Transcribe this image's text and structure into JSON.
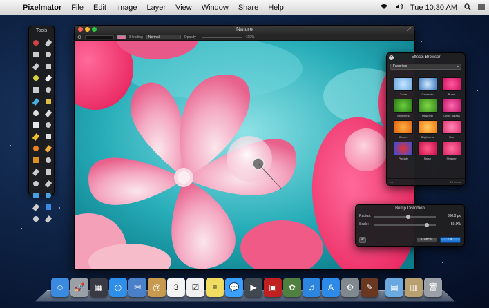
{
  "menubar": {
    "app_name": "Pixelmator",
    "items": [
      "File",
      "Edit",
      "Image",
      "Layer",
      "View",
      "Window",
      "Share",
      "Help"
    ],
    "clock": "Tue 10:30 AM"
  },
  "tools_palette": {
    "title": "Tools",
    "tools": [
      "move-tool",
      "arrow-select-tool",
      "rect-marquee-tool",
      "ellipse-marquee-tool",
      "lasso-tool",
      "polygon-lasso-tool",
      "magic-wand-tool",
      "eyedropper-tool",
      "crop-tool",
      "slice-tool",
      "brush-tool",
      "pencil-tool",
      "eraser-tool",
      "gradient-tool",
      "paint-bucket-tool",
      "blur-tool",
      "sponge-tool",
      "smudge-tool",
      "burn-tool",
      "dodge-tool",
      "clone-stamp-tool",
      "healing-tool",
      "red-eye-tool",
      "sharpen-tool",
      "pen-tool",
      "freeform-pen-tool",
      "line-tool",
      "shape-tool",
      "type-tool",
      "color-swatch",
      "zoom-tool",
      "hand-tool"
    ]
  },
  "main_window": {
    "title": "Nature",
    "options": {
      "blending_label": "Blending",
      "blending_value": "Normal",
      "opacity_label": "Opacity",
      "opacity_value": "100%"
    }
  },
  "effects_browser": {
    "title": "Effects Browser",
    "category": "Favorites",
    "effects": [
      {
        "label": "Zoom",
        "colors": [
          "#c8e4ff",
          "#6aa8e0"
        ]
      },
      {
        "label": "Gaussian",
        "colors": [
          "#d0e8ff",
          "#3a78c0"
        ]
      },
      {
        "label": "Bump",
        "colors": [
          "#ff5aa0",
          "#d0105e"
        ]
      },
      {
        "label": "Brickwork",
        "colors": [
          "#6ad040",
          "#2c7a14"
        ]
      },
      {
        "label": "Pinwheel",
        "colors": [
          "#7ed848",
          "#3a8a1c"
        ]
      },
      {
        "label": "Circle Splash",
        "colors": [
          "#ff6ab0",
          "#c0186a"
        ]
      },
      {
        "label": "Curves",
        "colors": [
          "#ffb040",
          "#e06010"
        ]
      },
      {
        "label": "Brightness",
        "colors": [
          "#ffc860",
          "#f07a10"
        ]
      },
      {
        "label": "Hue",
        "colors": [
          "#ff8ab8",
          "#e0306e"
        ]
      },
      {
        "label": "Pixelate",
        "colors": [
          "#e83030",
          "#3050e0"
        ]
      },
      {
        "label": "Noise",
        "colors": [
          "#ff5a8a",
          "#c8104a"
        ]
      },
      {
        "label": "Sharpen",
        "colors": [
          "#ff70a0",
          "#d82060"
        ]
      }
    ],
    "count": "15 Items"
  },
  "bump_distortion": {
    "title": "Bump Distortion",
    "radius_label": "Radius:",
    "radius_value": "300.0 px",
    "radius_level": 0.55,
    "scale_label": "Scale:",
    "scale_value": "50.0%",
    "scale_level": 0.85,
    "cancel_label": "Cancel",
    "ok_label": "OK"
  },
  "dock": {
    "apps": [
      {
        "name": "finder",
        "color": "#3a8ae0",
        "glyph": "☺"
      },
      {
        "name": "launchpad",
        "color": "#9aa0a8",
        "glyph": "🚀"
      },
      {
        "name": "mission-control",
        "color": "#3a3a44",
        "glyph": "▦"
      },
      {
        "name": "safari",
        "color": "#2f8fe8",
        "glyph": "◎"
      },
      {
        "name": "mail",
        "color": "#4a80c8",
        "glyph": "✉"
      },
      {
        "name": "contacts",
        "color": "#c89a50",
        "glyph": "@"
      },
      {
        "name": "calendar",
        "color": "#f4f4f4",
        "glyph": "3"
      },
      {
        "name": "reminders",
        "color": "#f0f0f0",
        "glyph": "☑"
      },
      {
        "name": "notes",
        "color": "#f0dc60",
        "glyph": "≡"
      },
      {
        "name": "messages",
        "color": "#3aa0ff",
        "glyph": "💬"
      },
      {
        "name": "facetime",
        "color": "#404850",
        "glyph": "▶"
      },
      {
        "name": "photo-booth",
        "color": "#c02020",
        "glyph": "▣"
      },
      {
        "name": "iphoto",
        "color": "#508040",
        "glyph": "✿"
      },
      {
        "name": "itunes",
        "color": "#2c86e0",
        "glyph": "♫"
      },
      {
        "name": "app-store",
        "color": "#2e8ae8",
        "glyph": "A"
      },
      {
        "name": "system-preferences",
        "color": "#808890",
        "glyph": "⚙"
      },
      {
        "name": "pixelmator",
        "color": "#6a3820",
        "glyph": "✎"
      },
      {
        "name": "applications-folder",
        "color": "#6aa8e0",
        "glyph": "▤"
      },
      {
        "name": "documents-stack",
        "color": "#b8a070",
        "glyph": "▥"
      },
      {
        "name": "trash",
        "color": "#9aa0a8",
        "glyph": "🗑"
      }
    ]
  }
}
